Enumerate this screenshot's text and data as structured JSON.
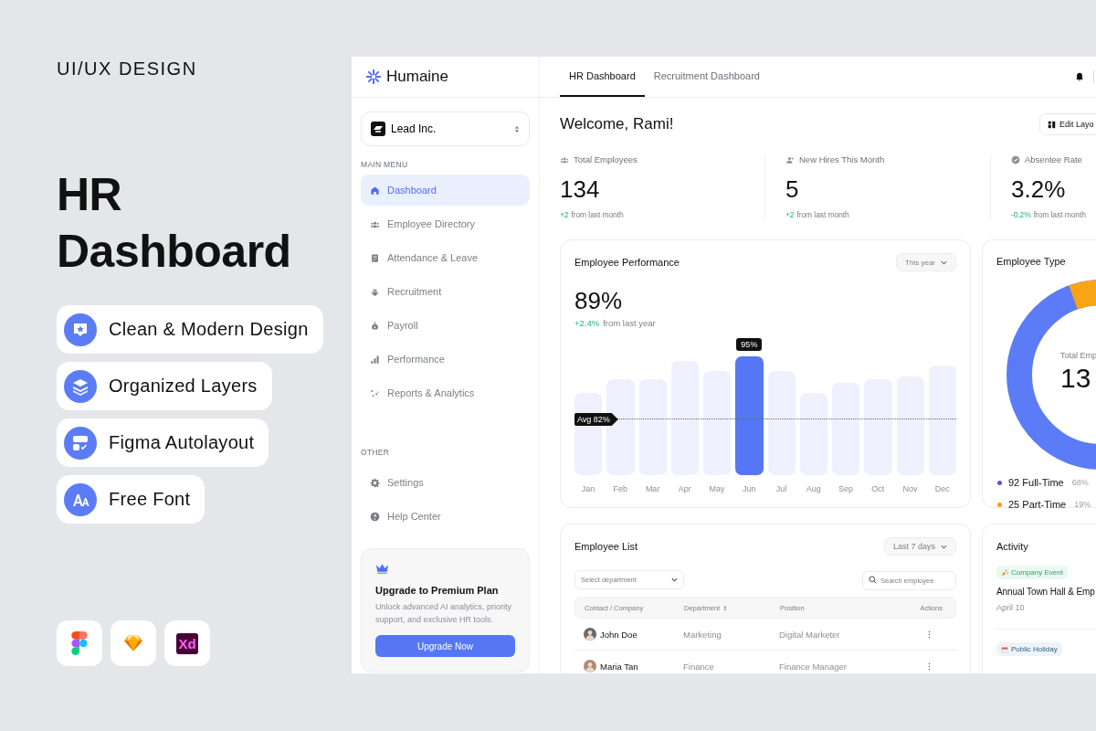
{
  "cover": {
    "eyebrow": "UI/UX DESIGN",
    "title": "HR Dashboard",
    "features": [
      {
        "label": "Clean & Modern Design"
      },
      {
        "label": "Organized Layers"
      },
      {
        "label": "Figma Autolayout"
      },
      {
        "label": "Free Font"
      }
    ],
    "tools": [
      {
        "kind": "figma"
      },
      {
        "kind": "sketch"
      },
      {
        "kind": "xd",
        "label": "Xd"
      }
    ]
  },
  "app": {
    "brand": "Humaine",
    "org": "Lead Inc.",
    "sections": [
      {
        "heading": "MAIN MENU",
        "items": [
          {
            "label": "Dashboard",
            "selected": true
          },
          {
            "label": "Employee Directory",
            "selected": false
          },
          {
            "label": "Attendance & Leave",
            "selected": false
          },
          {
            "label": "Recruitment",
            "selected": false
          },
          {
            "label": "Payroll",
            "selected": false
          },
          {
            "label": "Performance",
            "selected": false
          },
          {
            "label": "Reports & Analytics",
            "selected": false
          }
        ]
      },
      {
        "heading": "OTHER",
        "items": [
          {
            "label": "Settings",
            "selected": false
          },
          {
            "label": "Help Center",
            "selected": false
          }
        ]
      }
    ],
    "promo": {
      "title": "Upgrade to Premium Plan",
      "text": "Unlock advanced AI analytics, priority support, and exclusive HR tools.",
      "button": "Upgrade Now"
    },
    "tabs": [
      {
        "label": "HR Dashboard",
        "selected": true
      },
      {
        "label": "Recruitment Dashboard",
        "selected": false
      }
    ],
    "greeting": "Welcome, Rami!",
    "edit_button": "Edit Layo",
    "stats": [
      {
        "label": "Total Employees",
        "value": "134",
        "delta": "+2",
        "note": "from last month",
        "positive": true
      },
      {
        "label": "New Hires This Month",
        "value": "5",
        "delta": "+2",
        "note": "from last month",
        "positive": true
      },
      {
        "label": "Absentee Rate",
        "value": "3.2%",
        "delta": "-0.2%",
        "note": "from last month",
        "positive": true
      }
    ],
    "performance": {
      "title": "Employee Performance",
      "period": "This year",
      "value": "89%",
      "delta": "+2.4%",
      "note": "from last year",
      "average": "Avg 82%",
      "tooltip": "95%",
      "months": [
        {
          "label": "Jan",
          "selected": false
        },
        {
          "label": "Feb",
          "selected": false
        },
        {
          "label": "Mar",
          "selected": false
        },
        {
          "label": "Apr",
          "selected": false
        },
        {
          "label": "May",
          "selected": false
        },
        {
          "label": "Jun",
          "selected": true
        },
        {
          "label": "Jul",
          "selected": false
        },
        {
          "label": "Aug",
          "selected": false
        },
        {
          "label": "Sep",
          "selected": false
        },
        {
          "label": "Oct",
          "selected": false
        },
        {
          "label": "Nov",
          "selected": false
        },
        {
          "label": "Dec",
          "selected": false
        }
      ]
    },
    "employee_type": {
      "title": "Employee Type",
      "center_label": "Total Emp",
      "center_value": "13",
      "legend": [
        {
          "count": "92 Full-Time",
          "share": "68%",
          "color": "#5b52d8"
        },
        {
          "count": "25 Part-Time",
          "share": "19%",
          "color": "#f59e0b"
        }
      ]
    },
    "employee_list": {
      "title": "Employee List",
      "period": "Last 7 days",
      "department_placeholder": "Select department",
      "search_placeholder": "Search employee",
      "columns": [
        {
          "label": "Contact / Company",
          "sortable": false
        },
        {
          "label": "Department",
          "sortable": true
        },
        {
          "label": "Position",
          "sortable": false
        },
        {
          "label": "Actions",
          "sortable": false
        }
      ],
      "rows": [
        {
          "name": "John Doe",
          "department": "Marketing",
          "position": "Digital Marketer"
        },
        {
          "name": "Maria Tan",
          "department": "Finance",
          "position": "Finance Manager"
        }
      ]
    },
    "activity": {
      "title": "Activity",
      "items": [
        {
          "kind": "event",
          "tag": "Company Event",
          "title": "Annual Town Hall & Emp",
          "date": "April 10"
        },
        {
          "kind": "holiday",
          "tag": "Public Holiday"
        }
      ]
    }
  }
}
